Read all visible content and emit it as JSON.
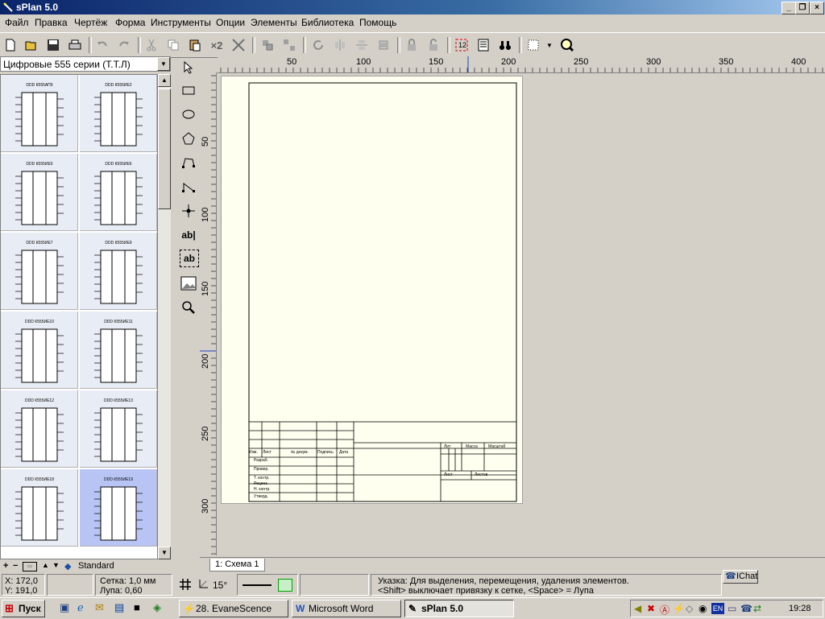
{
  "window": {
    "title": "sPlan 5.0",
    "buttons": [
      "minimize",
      "maximize",
      "close"
    ]
  },
  "menu": [
    "Файл",
    "Правка",
    "Чертёж",
    "Форма",
    "Инструменты",
    "Опции",
    "Элементы",
    "Библиотека",
    "Помощь"
  ],
  "toolbar": {
    "icons": [
      "new-icon",
      "open-icon",
      "save-icon",
      "print-icon",
      "undo-icon",
      "redo-icon",
      "cut-icon",
      "copy-icon",
      "paste-icon",
      "duplicate-icon",
      "delete-icon",
      "group-icon",
      "ungroup-icon",
      "rotate-icon",
      "mirror-h-icon",
      "mirror-v-icon",
      "align-icon",
      "lock-icon",
      "unlock-icon",
      "numbering-icon",
      "parts-list-icon",
      "binoculars-icon",
      "grid-icon",
      "zoom-icon"
    ],
    "duplicate_label": "×2"
  },
  "library": {
    "selected": "Цифровые 555 серии (Т.Т.Л)",
    "items": [
      {
        "label": "DDD К555АП9",
        "sel": false
      },
      {
        "label": "DDD К555ИЕ2",
        "sel": false
      },
      {
        "label": "DDD К555ИЕ5",
        "sel": false
      },
      {
        "label": "DDD К555ИЕ6",
        "sel": false
      },
      {
        "label": "DDD К555ИЕ7",
        "sel": false
      },
      {
        "label": "DDD К555ИЕ9",
        "sel": false
      },
      {
        "label": "DDD К555ИЕ10",
        "sel": false
      },
      {
        "label": "DDD К555ИЕ11",
        "sel": false
      },
      {
        "label": "DDD К555ИЕ12",
        "sel": false
      },
      {
        "label": "DDD К555ИЕ13",
        "sel": false
      },
      {
        "label": "DDD К555ИЕ18",
        "sel": false
      },
      {
        "label": "DDD К555ИЕ19",
        "sel": true
      }
    ],
    "footer_label": "Standard"
  },
  "tools": {
    "icons": [
      "pointer-icon",
      "rectangle-icon",
      "ellipse-icon",
      "polygon-icon",
      "bezier-icon",
      "line-icon",
      "junction-icon",
      "text-icon",
      "textbox-icon",
      "image-icon",
      "magnifier-icon"
    ],
    "text_label": "ab|",
    "textbox_label": "ab"
  },
  "rulers": {
    "x": [
      "50",
      "100",
      "150",
      "200",
      "250",
      "300",
      "350",
      "400"
    ],
    "y": [
      "50",
      "100",
      "150",
      "200",
      "250",
      "300"
    ]
  },
  "titleblock": {
    "col_headers": [
      "Изм.",
      "Лист",
      "№ докум.",
      "Подпись",
      "Дата"
    ],
    "rows": [
      "Разраб.",
      "Провер.",
      "Т. контр.",
      "Реценз.",
      "Н. контр.",
      "Утверд."
    ],
    "right_headers": [
      "Лит",
      "Масса",
      "Масштаб"
    ],
    "sheet": "Лист",
    "sheets": "Листов"
  },
  "sheet_tab": "1: Схема 1",
  "status": {
    "x": "X: 172,0",
    "y": "Y: 191,0",
    "grid": "Сетка: 1,0 мм",
    "zoom": "Лупа:  0,60",
    "angle": "15°",
    "hint1": "Указка: Для выделения, перемещения, удаления элементов.",
    "hint2": "<Shift> выключает привязку к сетке, <Space> = Лупа",
    "ichat": "IChat"
  },
  "taskbar": {
    "start": "Пуск",
    "buttons": [
      {
        "label": "28. EvaneScence",
        "active": false
      },
      {
        "label": "Microsoft Word",
        "active": false
      },
      {
        "label": "sPlan 5.0",
        "active": true
      }
    ],
    "lang": "EN",
    "clock": "19:28"
  }
}
